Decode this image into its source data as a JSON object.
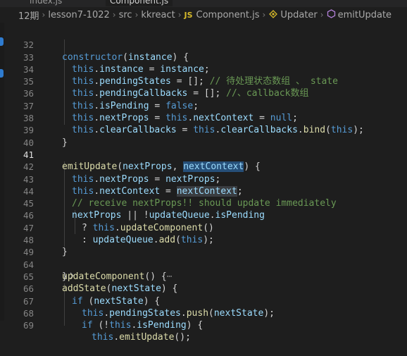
{
  "tabs": [
    {
      "label": "index.js",
      "active": false
    },
    {
      "label": "Component.js",
      "active": true
    }
  ],
  "breadcrumb": {
    "items": [
      "12期",
      "lesson7-1022",
      "src",
      "kkreact"
    ],
    "file_badge": "JS",
    "file": "Component.js",
    "symbol1": "Updater",
    "symbol2": "emitUpdate"
  },
  "editor": {
    "current_line": "41",
    "lines": [
      {
        "n": "32",
        "code": "constructor(instance) {"
      },
      {
        "n": "33",
        "code": "this.instance = instance;"
      },
      {
        "n": "34",
        "code": "this.pendingStates = []; ",
        "comment": "// 待处理状态数组 、 state"
      },
      {
        "n": "35",
        "code": "this.pendingCallbacks = []; ",
        "comment": "//、callback数组"
      },
      {
        "n": "36",
        "code": "this.isPending = false;"
      },
      {
        "n": "37",
        "code": "this.nextProps = this.nextContext = null;"
      },
      {
        "n": "38",
        "code": "this.clearCallbacks = this.clearCallbacks.bind(this);"
      },
      {
        "n": "39",
        "code": "}"
      },
      {
        "n": "40",
        "code": ""
      },
      {
        "n": "41",
        "code": "emitUpdate(nextProps, nextContext) {"
      },
      {
        "n": "42",
        "code": "this.nextProps = nextProps;"
      },
      {
        "n": "43",
        "code": "this.nextContext = nextContext;"
      },
      {
        "n": "44",
        "comment": "// receive nextProps!! should update immediately"
      },
      {
        "n": "45",
        "code": "nextProps || !updateQueue.isPending"
      },
      {
        "n": "46",
        "code": "? this.updateComponent()"
      },
      {
        "n": "47",
        "code": ": updateQueue.add(this);"
      },
      {
        "n": "48",
        "code": "}"
      },
      {
        "n": "49",
        "code": "updateComponent() {",
        "folded": "⋯"
      },
      {
        "n": "64",
        "code": "}"
      },
      {
        "n": "65",
        "code": "addState(nextState) {"
      },
      {
        "n": "66",
        "code": "if (nextState) {"
      },
      {
        "n": "67",
        "code": "this.pendingStates.push(nextState);"
      },
      {
        "n": "68",
        "code": "if (!this.isPending) {"
      },
      {
        "n": "69",
        "code": "this.emitUpdate();"
      }
    ]
  }
}
